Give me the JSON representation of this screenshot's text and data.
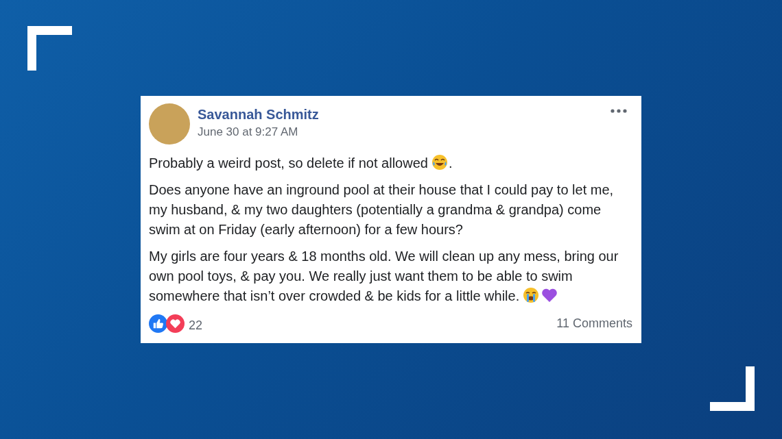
{
  "post": {
    "author": "Savannah Schmitz",
    "time": "June 30 at 9:27 AM",
    "paragraphs": [
      [
        {
          "kind": "text",
          "text": "Probably a weird post, so delete if not allowed"
        },
        {
          "kind": "laugh"
        },
        {
          "kind": "text",
          "text": "."
        }
      ],
      [
        {
          "kind": "text",
          "text": "Does anyone have an inground pool at their house that I could pay to let me, my husband, & my two daughters (potentially a grandma & grandpa) come swim at on Friday (early afternoon) for a few hours?"
        }
      ],
      [
        {
          "kind": "block",
          "text": "My girls are four years & 18 months old. We will clean up any mess, bring our own pool toys, & pay you. We really just want them to be able to swim"
        },
        {
          "kind": "text",
          "text": "somewhere that isn’t over crowded & be kids for a little while."
        },
        {
          "kind": "cry"
        },
        {
          "kind": "heart"
        }
      ]
    ],
    "reaction_count": "22",
    "comments": "11 Comments"
  }
}
